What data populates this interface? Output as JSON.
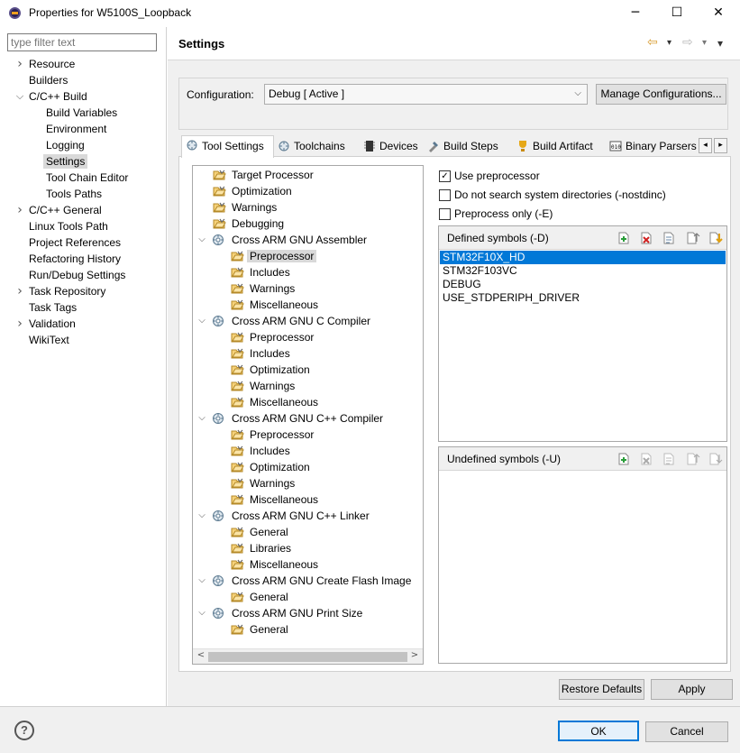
{
  "window": {
    "title": "Properties for W5100S_Loopback",
    "minimize_glyph": "─",
    "maximize_glyph": "☐",
    "close_glyph": "✕"
  },
  "sidebar": {
    "filter_placeholder": "type filter text",
    "items": [
      {
        "label": "Resource",
        "expander": ">"
      },
      {
        "label": "Builders"
      },
      {
        "label": "C/C++ Build",
        "expander": "v"
      },
      {
        "label": "Build Variables"
      },
      {
        "label": "Environment"
      },
      {
        "label": "Logging"
      },
      {
        "label": "Settings",
        "selected": true
      },
      {
        "label": "Tool Chain Editor"
      },
      {
        "label": "Tools Paths"
      },
      {
        "label": "C/C++ General",
        "expander": ">"
      },
      {
        "label": "Linux Tools Path"
      },
      {
        "label": "Project References"
      },
      {
        "label": "Refactoring History"
      },
      {
        "label": "Run/Debug Settings"
      },
      {
        "label": "Task Repository",
        "expander": ">"
      },
      {
        "label": "Task Tags"
      },
      {
        "label": "Validation",
        "expander": ">"
      },
      {
        "label": "WikiText"
      }
    ]
  },
  "header": {
    "title": "Settings",
    "back_glyph": "⇦",
    "forward_glyph": "⇨",
    "dropdown_glyph": "▾"
  },
  "configuration": {
    "label": "Configuration:",
    "value": "Debug  [ Active ]",
    "manage_label": "Manage Configurations..."
  },
  "tabs": [
    {
      "label": "Tool Settings",
      "icon": "tool-settings-icon",
      "active": true
    },
    {
      "label": "Toolchains",
      "icon": "toolchains-icon"
    },
    {
      "label": "Devices",
      "icon": "devices-icon"
    },
    {
      "label": "Build Steps",
      "icon": "build-steps-icon"
    },
    {
      "label": "Build Artifact",
      "icon": "build-artifact-icon"
    },
    {
      "label": "Binary Parsers",
      "icon": "binary-parsers-icon"
    }
  ],
  "tree": {
    "items": [
      {
        "label": "Target Processor",
        "level": 0,
        "type": "folder"
      },
      {
        "label": "Optimization",
        "level": 0,
        "type": "folder"
      },
      {
        "label": "Warnings",
        "level": 0,
        "type": "folder"
      },
      {
        "label": "Debugging",
        "level": 0,
        "type": "folder"
      },
      {
        "label": "Cross ARM GNU Assembler",
        "level": 0,
        "type": "tool"
      },
      {
        "label": "Preprocessor",
        "level": 1,
        "type": "folder",
        "selected": true
      },
      {
        "label": "Includes",
        "level": 1,
        "type": "folder"
      },
      {
        "label": "Warnings",
        "level": 1,
        "type": "folder"
      },
      {
        "label": "Miscellaneous",
        "level": 1,
        "type": "folder"
      },
      {
        "label": "Cross ARM GNU C Compiler",
        "level": 0,
        "type": "tool"
      },
      {
        "label": "Preprocessor",
        "level": 1,
        "type": "folder"
      },
      {
        "label": "Includes",
        "level": 1,
        "type": "folder"
      },
      {
        "label": "Optimization",
        "level": 1,
        "type": "folder"
      },
      {
        "label": "Warnings",
        "level": 1,
        "type": "folder"
      },
      {
        "label": "Miscellaneous",
        "level": 1,
        "type": "folder"
      },
      {
        "label": "Cross ARM GNU C++ Compiler",
        "level": 0,
        "type": "tool"
      },
      {
        "label": "Preprocessor",
        "level": 1,
        "type": "folder"
      },
      {
        "label": "Includes",
        "level": 1,
        "type": "folder"
      },
      {
        "label": "Optimization",
        "level": 1,
        "type": "folder"
      },
      {
        "label": "Warnings",
        "level": 1,
        "type": "folder"
      },
      {
        "label": "Miscellaneous",
        "level": 1,
        "type": "folder"
      },
      {
        "label": "Cross ARM GNU C++ Linker",
        "level": 0,
        "type": "tool"
      },
      {
        "label": "General",
        "level": 1,
        "type": "folder"
      },
      {
        "label": "Libraries",
        "level": 1,
        "type": "folder"
      },
      {
        "label": "Miscellaneous",
        "level": 1,
        "type": "folder"
      },
      {
        "label": "Cross ARM GNU Create Flash Image",
        "level": 0,
        "type": "tool"
      },
      {
        "label": "General",
        "level": 1,
        "type": "folder"
      },
      {
        "label": "Cross ARM GNU Print Size",
        "level": 0,
        "type": "tool"
      },
      {
        "label": "General",
        "level": 1,
        "type": "folder"
      }
    ]
  },
  "options": {
    "use_preprocessor": {
      "label": "Use preprocessor",
      "checked": true
    },
    "no_system_dirs": {
      "label": "Do not search system directories (-nostdinc)",
      "checked": false
    },
    "preprocess_only": {
      "label": "Preprocess only (-E)",
      "checked": false
    }
  },
  "defined_symbols": {
    "title": "Defined symbols (-D)",
    "items": [
      "STM32F10X_HD",
      "STM32F103VC",
      "DEBUG",
      "USE_STDPERIPH_DRIVER"
    ],
    "selected_index": 0
  },
  "undefined_symbols": {
    "title": "Undefined symbols (-U)",
    "items": []
  },
  "buttons": {
    "restore_defaults": "Restore Defaults",
    "apply": "Apply",
    "ok": "OK",
    "cancel": "Cancel",
    "help": "?"
  },
  "colors": {
    "selection": "#0078d7",
    "ok_border": "#0078d7",
    "panel_bg": "#f0f0f0"
  }
}
